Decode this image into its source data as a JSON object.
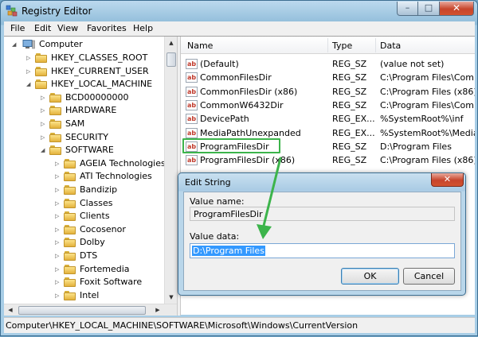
{
  "window": {
    "title": "Registry Editor"
  },
  "controls": {
    "minimize": "–",
    "maximize": "□",
    "close": "✕"
  },
  "menu": [
    "File",
    "Edit",
    "View",
    "Favorites",
    "Help"
  ],
  "tree": {
    "root": "Computer",
    "items": [
      {
        "label": "HKEY_CLASSES_ROOT",
        "state": "collapsed"
      },
      {
        "label": "HKEY_CURRENT_USER",
        "state": "collapsed"
      },
      {
        "label": "HKEY_LOCAL_MACHINE",
        "state": "expanded"
      },
      {
        "label": "BCD00000000",
        "state": "collapsed"
      },
      {
        "label": "HARDWARE",
        "state": "collapsed"
      },
      {
        "label": "SAM",
        "state": "collapsed"
      },
      {
        "label": "SECURITY",
        "state": "collapsed"
      },
      {
        "label": "SOFTWARE",
        "state": "expanded"
      },
      {
        "label": "AGEIA Technologies",
        "state": "collapsed"
      },
      {
        "label": "ATI Technologies",
        "state": "collapsed"
      },
      {
        "label": "Bandizip",
        "state": "collapsed"
      },
      {
        "label": "Classes",
        "state": "collapsed"
      },
      {
        "label": "Clients",
        "state": "collapsed"
      },
      {
        "label": "Cocosenor",
        "state": "collapsed"
      },
      {
        "label": "Dolby",
        "state": "collapsed"
      },
      {
        "label": "DTS",
        "state": "collapsed"
      },
      {
        "label": "Fortemedia",
        "state": "collapsed"
      },
      {
        "label": "Foxit Software",
        "state": "collapsed"
      },
      {
        "label": "Intel",
        "state": "collapsed"
      }
    ]
  },
  "list": {
    "columns": [
      "Name",
      "Type",
      "Data"
    ],
    "rows": [
      {
        "name": "(Default)",
        "type": "REG_SZ",
        "data": "(value not set)"
      },
      {
        "name": "CommonFilesDir",
        "type": "REG_SZ",
        "data": "C:\\Program Files\\Comm"
      },
      {
        "name": "CommonFilesDir (x86)",
        "type": "REG_SZ",
        "data": "C:\\Program Files (x86)\\C"
      },
      {
        "name": "CommonW6432Dir",
        "type": "REG_SZ",
        "data": "C:\\Program Files\\Comm"
      },
      {
        "name": "DevicePath",
        "type": "REG_EX...",
        "data": "%SystemRoot%\\inf"
      },
      {
        "name": "MediaPathUnexpanded",
        "type": "REG_EX...",
        "data": "%SystemRoot%\\Media"
      },
      {
        "name": "ProgramFilesDir",
        "type": "REG_SZ",
        "data": "D:\\Program Files"
      },
      {
        "name": "ProgramFilesDir (x86)",
        "type": "REG_SZ",
        "data": "C:\\Program Files (x86)"
      }
    ],
    "value_icon": "ab"
  },
  "status": "Computer\\HKEY_LOCAL_MACHINE\\SOFTWARE\\Microsoft\\Windows\\CurrentVersion",
  "dialog": {
    "title": "Edit String",
    "close": "✕",
    "value_name_label": "Value name:",
    "value_name": "ProgramFilesDir",
    "value_data_label": "Value data:",
    "value_data": "D:\\Program Files",
    "ok": "OK",
    "cancel": "Cancel"
  },
  "colors": {
    "highlight": "#3cb44b",
    "selection": "#3399ff"
  }
}
